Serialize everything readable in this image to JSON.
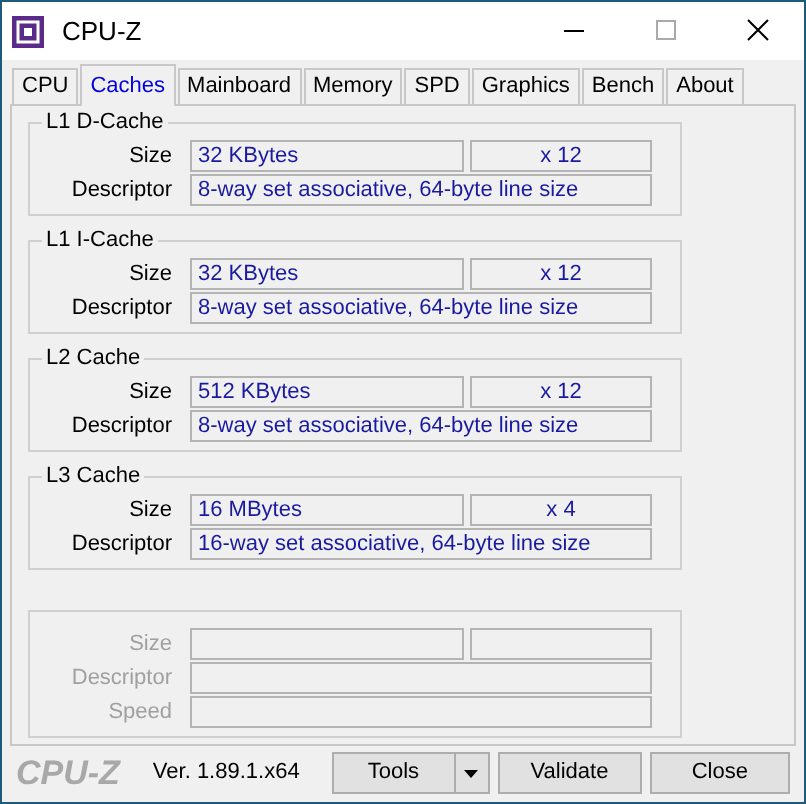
{
  "window": {
    "title": "CPU-Z"
  },
  "tabs": [
    {
      "label": "CPU",
      "selected": false
    },
    {
      "label": "Caches",
      "selected": true
    },
    {
      "label": "Mainboard",
      "selected": false
    },
    {
      "label": "Memory",
      "selected": false
    },
    {
      "label": "SPD",
      "selected": false
    },
    {
      "label": "Graphics",
      "selected": false
    },
    {
      "label": "Bench",
      "selected": false
    },
    {
      "label": "About",
      "selected": false
    }
  ],
  "groups": [
    {
      "title": "L1 D-Cache",
      "disabled": false,
      "rows": [
        {
          "kind": "pair",
          "label": "Size",
          "value": "32 KBytes",
          "count": "x 12"
        },
        {
          "kind": "single",
          "label": "Descriptor",
          "value": "8-way set associative, 64-byte line size"
        }
      ]
    },
    {
      "title": "L1 I-Cache",
      "disabled": false,
      "rows": [
        {
          "kind": "pair",
          "label": "Size",
          "value": "32 KBytes",
          "count": "x 12"
        },
        {
          "kind": "single",
          "label": "Descriptor",
          "value": "8-way set associative, 64-byte line size"
        }
      ]
    },
    {
      "title": "L2 Cache",
      "disabled": false,
      "rows": [
        {
          "kind": "pair",
          "label": "Size",
          "value": "512 KBytes",
          "count": "x 12"
        },
        {
          "kind": "single",
          "label": "Descriptor",
          "value": "8-way set associative, 64-byte line size"
        }
      ]
    },
    {
      "title": "L3 Cache",
      "disabled": false,
      "rows": [
        {
          "kind": "pair",
          "label": "Size",
          "value": "16 MBytes",
          "count": "x 4"
        },
        {
          "kind": "single",
          "label": "Descriptor",
          "value": "16-way set associative, 64-byte line size"
        }
      ]
    },
    {
      "disabled": true,
      "rows": [
        {
          "kind": "pair",
          "label": "Size"
        },
        {
          "kind": "single",
          "label": "Descriptor"
        },
        {
          "kind": "single",
          "label": "Speed"
        }
      ]
    }
  ],
  "footer": {
    "logo": "CPU-Z",
    "version": "Ver. 1.89.1.x64",
    "tools": "Tools",
    "validate": "Validate",
    "close": "Close"
  }
}
